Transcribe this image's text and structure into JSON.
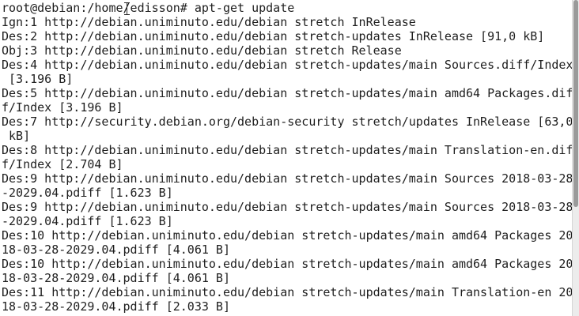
{
  "terminal": {
    "lines": [
      "root@debian:/home/edisson# apt-get update",
      "Ign:1 http://debian.uniminuto.edu/debian stretch InRelease",
      "Des:2 http://debian.uniminuto.edu/debian stretch-updates InRelease [91,0 kB]",
      "Obj:3 http://debian.uniminuto.edu/debian stretch Release",
      "Des:4 http://debian.uniminuto.edu/debian stretch-updates/main Sources.diff/Index",
      " [3.196 B]",
      "Des:5 http://debian.uniminuto.edu/debian stretch-updates/main amd64 Packages.dif",
      "f/Index [3.196 B]",
      "Des:7 http://security.debian.org/debian-security stretch/updates InRelease [63,0",
      " kB]",
      "Des:8 http://debian.uniminuto.edu/debian stretch-updates/main Translation-en.dif",
      "f/Index [2.704 B]",
      "Des:9 http://debian.uniminuto.edu/debian stretch-updates/main Sources 2018-03-28",
      "-2029.04.pdiff [1.623 B]",
      "Des:9 http://debian.uniminuto.edu/debian stretch-updates/main Sources 2018-03-28",
      "-2029.04.pdiff [1.623 B]",
      "Des:10 http://debian.uniminuto.edu/debian stretch-updates/main amd64 Packages 20",
      "18-03-28-2029.04.pdiff [4.061 B]",
      "Des:10 http://debian.uniminuto.edu/debian stretch-updates/main amd64 Packages 20",
      "18-03-28-2029.04.pdiff [4.061 B]",
      "Des:11 http://debian.uniminuto.edu/debian stretch-updates/main Translation-en 20",
      "18-03-28-2029.04.pdiff [2.033 B]"
    ]
  }
}
